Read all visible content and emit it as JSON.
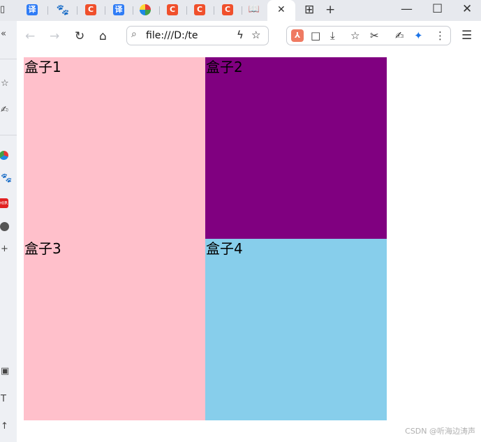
{
  "tabs": [
    {
      "icon": "translate-icon",
      "glyph": "译"
    },
    {
      "icon": "baidu-paw-icon",
      "glyph": "🐾"
    },
    {
      "icon": "csdn-icon",
      "glyph": "C"
    },
    {
      "icon": "translate-icon",
      "glyph": "译"
    },
    {
      "icon": "colorful-drop-icon",
      "glyph": ""
    },
    {
      "icon": "csdn-icon",
      "glyph": "C"
    },
    {
      "icon": "csdn-icon",
      "glyph": "C"
    },
    {
      "icon": "csdn-icon",
      "glyph": "C"
    },
    {
      "icon": "reading-mode-icon",
      "glyph": "📖"
    }
  ],
  "address_bar": {
    "value": "file:///D:/te"
  },
  "boxes": [
    {
      "label": "盒子1",
      "color": "#ffc0cb"
    },
    {
      "label": "盒子2",
      "color": "#800080"
    },
    {
      "label": "盒子3",
      "color": "#ffc0cb"
    },
    {
      "label": "盒子4",
      "color": "#87ceeb"
    }
  ],
  "sidebar": {
    "red_badge_text": "HIR"
  },
  "watermark": "CSDN @听海边涛声"
}
